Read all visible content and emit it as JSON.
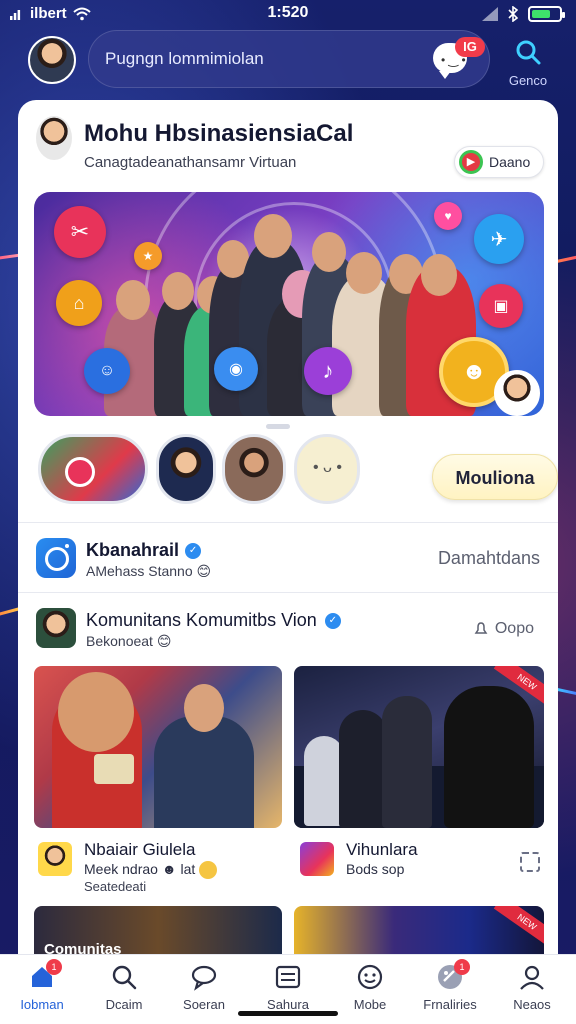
{
  "status_bar": {
    "carrier": "ilbert",
    "time": "1:520"
  },
  "header": {
    "search_placeholder": "Pugngn lommimiolan",
    "chat_badge": "IG",
    "search_button_label": "Genco"
  },
  "profile": {
    "title": "Mohu HbsinasiensiaCal",
    "subtitle": "Canagtadeanathansamr Virtuan",
    "live_label": "Daano"
  },
  "follow_button": "Mouliona",
  "row_account": {
    "name": "Kbanahrail",
    "sub": "AMehass Stanno",
    "right": "Damahtdans"
  },
  "row_community": {
    "name": "Komunitans Komumitbs Vion",
    "sub": "Bekonoeat",
    "right": "Oopo"
  },
  "posts": [
    {
      "title": "Nbaiair Giulela",
      "sub1": "Meek ndrao",
      "sub1_extra": "lat",
      "sub2": "Seatedeati"
    },
    {
      "title": "Vihunlara",
      "sub1": "Bods sop"
    }
  ],
  "bottom_tile_label": "Comunitas",
  "bottom_nav": [
    {
      "label": "Iobman",
      "icon": "home-icon",
      "badge": "1",
      "active": true
    },
    {
      "label": "Dcaim",
      "icon": "search-icon"
    },
    {
      "label": "Soeran",
      "icon": "chat-icon"
    },
    {
      "label": "Sahura",
      "icon": "list-icon"
    },
    {
      "label": "Mobe",
      "icon": "smiley-icon"
    },
    {
      "label": "Frnaliries",
      "icon": "apps-icon",
      "badge": "1"
    },
    {
      "label": "Neaos",
      "icon": "profile-icon"
    }
  ],
  "colors": {
    "accent": "#2563d9",
    "badge": "#f23b4a",
    "background": "#101a5e"
  }
}
